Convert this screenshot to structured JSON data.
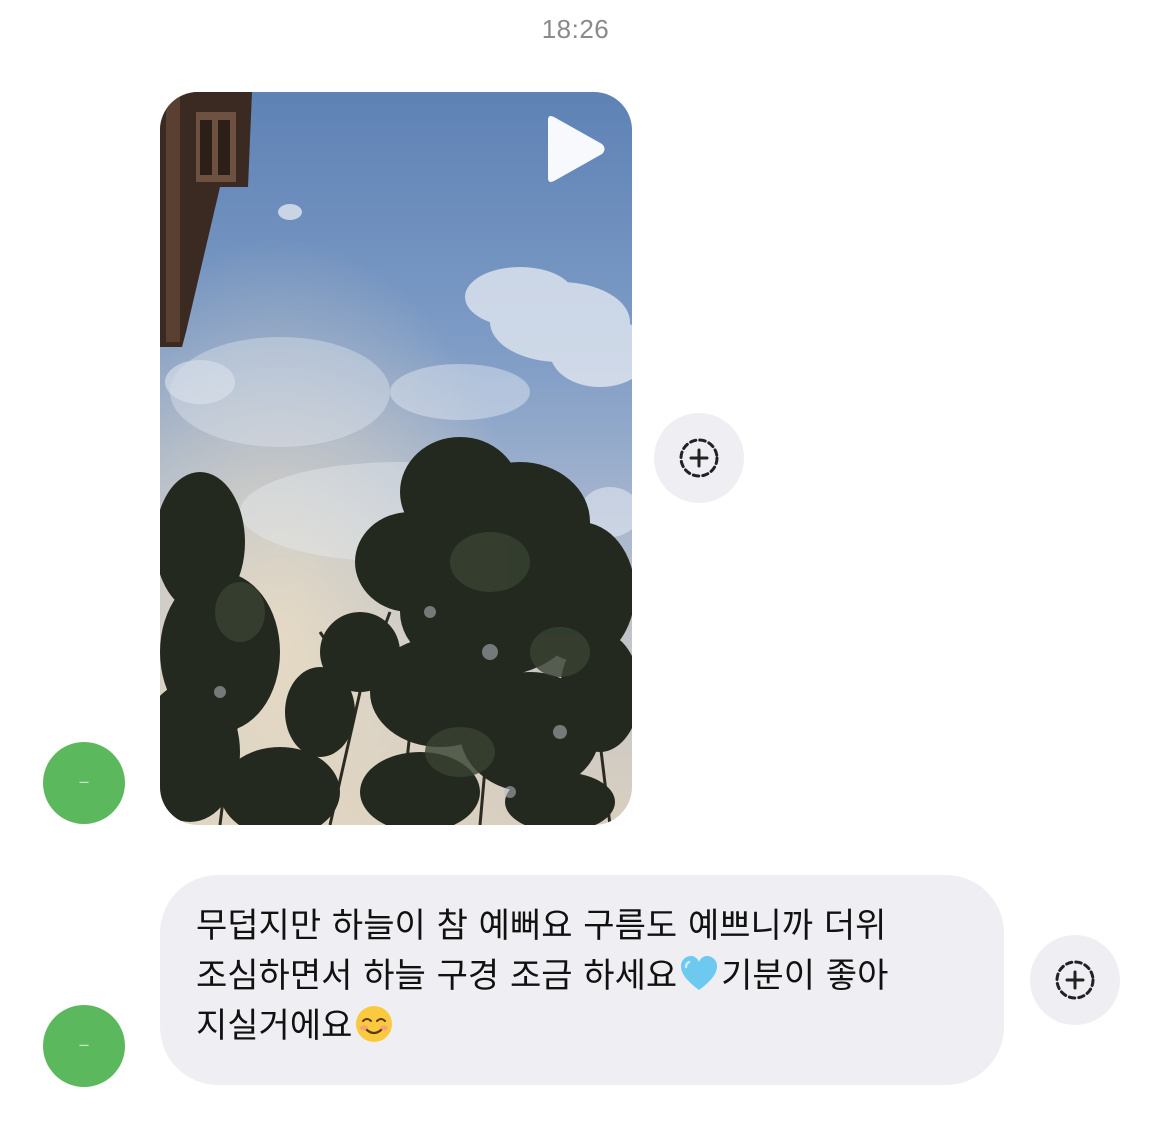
{
  "timestamp": "18:26",
  "avatars": [
    {
      "label": "avatar"
    },
    {
      "label": "avatar"
    }
  ],
  "video_message": {
    "content": "video of blue sky with clouds and trees",
    "play_icon": "play-icon"
  },
  "reaction_icon": "add-reaction-icon",
  "text_message": {
    "line1": "무덥지만 하늘이 참 예뻐요 구름도 예쁘니까 더위",
    "line2_a": "조심하면서 하늘 구경 조금 하세요",
    "line2_b": "기분이 좋아",
    "line3": "지실거에요",
    "emoji_1": "light-blue-heart",
    "emoji_2": "smiling-face"
  },
  "colors": {
    "avatar": "#5cb85c",
    "bubble": "#efeff3",
    "timestamp": "#8a8a8e"
  }
}
